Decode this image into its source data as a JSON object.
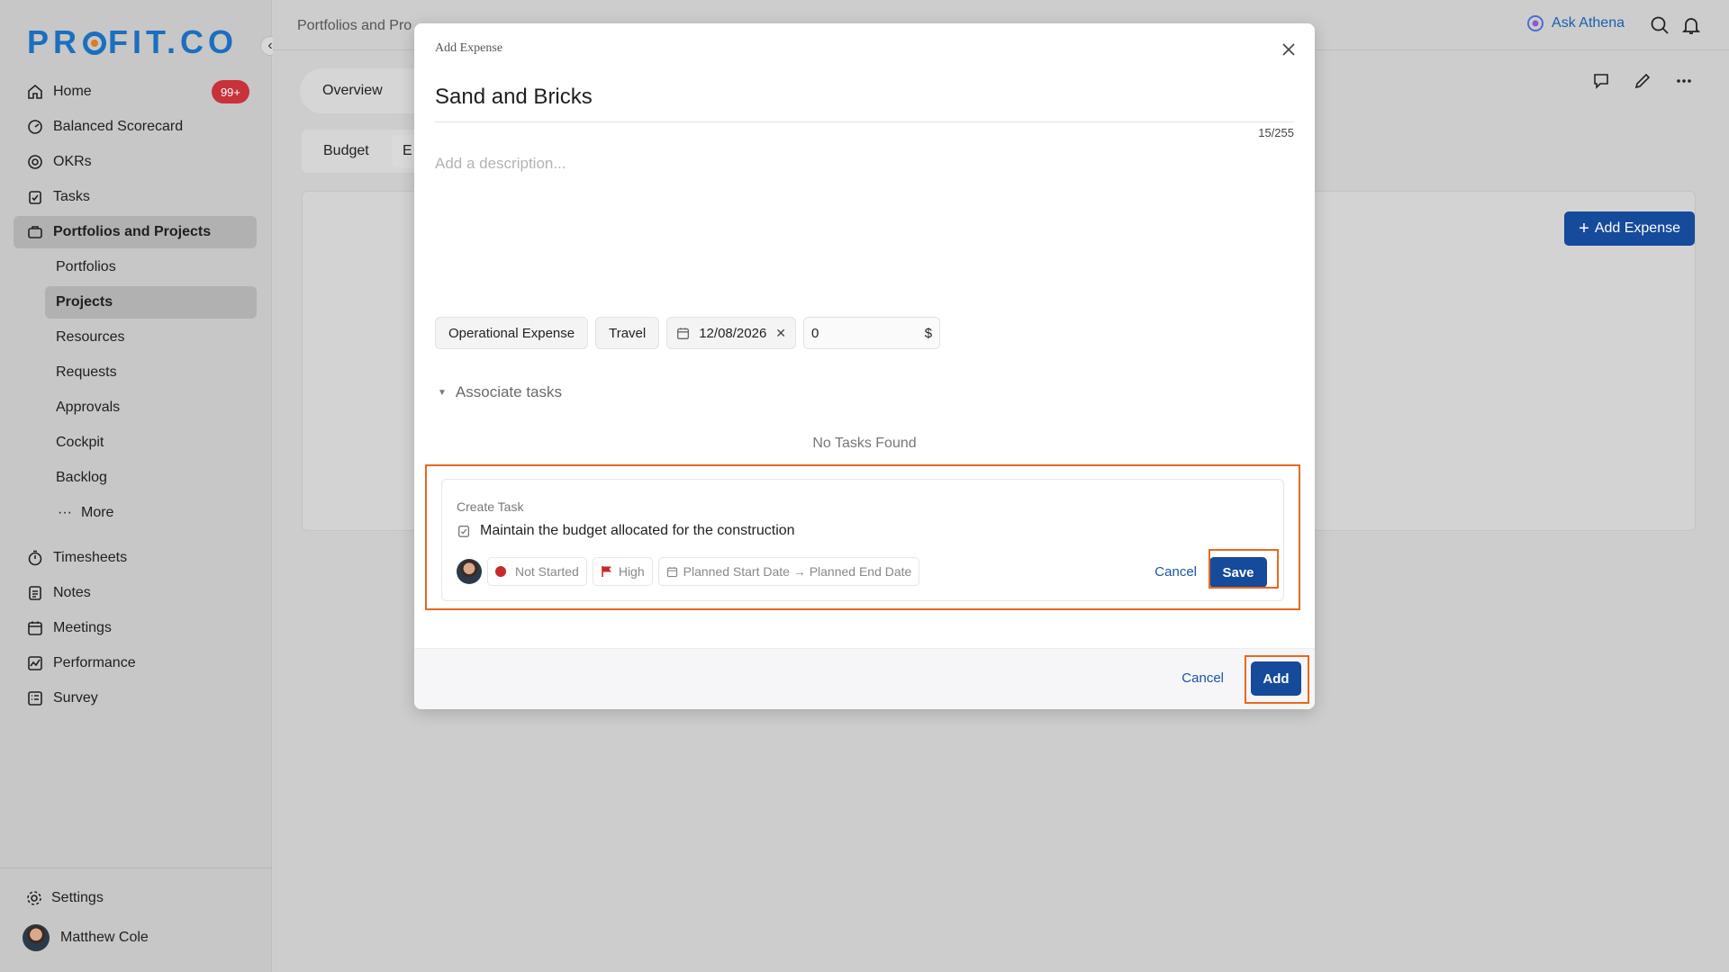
{
  "sidebar": {
    "logo": "PROFIT.CO",
    "home": {
      "label": "Home",
      "badge": "99+"
    },
    "items": [
      {
        "label": "Balanced Scorecard"
      },
      {
        "label": "OKRs"
      },
      {
        "label": "Tasks"
      },
      {
        "label": "Portfolios and Projects"
      }
    ],
    "sub_items": [
      {
        "label": "Portfolios"
      },
      {
        "label": "Projects"
      },
      {
        "label": "Resources"
      },
      {
        "label": "Requests"
      },
      {
        "label": "Approvals"
      },
      {
        "label": "Cockpit"
      },
      {
        "label": "Backlog"
      },
      {
        "label": "More"
      }
    ],
    "items2": [
      {
        "label": "Timesheets"
      },
      {
        "label": "Notes"
      },
      {
        "label": "Meetings"
      },
      {
        "label": "Performance"
      },
      {
        "label": "Survey"
      }
    ],
    "settings": "Settings",
    "user": "Matthew Cole"
  },
  "topbar": {
    "breadcrumb": "Portfolios and Pro",
    "ask_athena": "Ask Athena"
  },
  "page": {
    "tab_overview": "Overview",
    "tab_budget": "Budget",
    "tab_partial": "E",
    "add_expense_button": "Add Expense"
  },
  "modal": {
    "title": "Add Expense",
    "name": "Sand and Bricks",
    "char_count": "15/255",
    "description_placeholder": "Add a description...",
    "chips": {
      "category": "Operational Expense",
      "sub_category": "Travel",
      "date": "12/08/2026",
      "amount": "0",
      "currency": "$"
    },
    "associate_tasks": "Associate tasks",
    "no_tasks": "No Tasks Found",
    "create_task": {
      "label": "Create Task",
      "task_name": "Maintain the budget allocated for the construction",
      "status": "Not Started",
      "priority": "High",
      "dates": "Planned Start Date → Planned End Date",
      "cancel": "Cancel",
      "save": "Save"
    },
    "footer": {
      "cancel": "Cancel",
      "add": "Add"
    }
  },
  "colors": {
    "brand_blue": "#164a9b",
    "highlight_orange": "#e8691e",
    "badge_red": "#c8323a",
    "status_red": "#c52b2b"
  }
}
